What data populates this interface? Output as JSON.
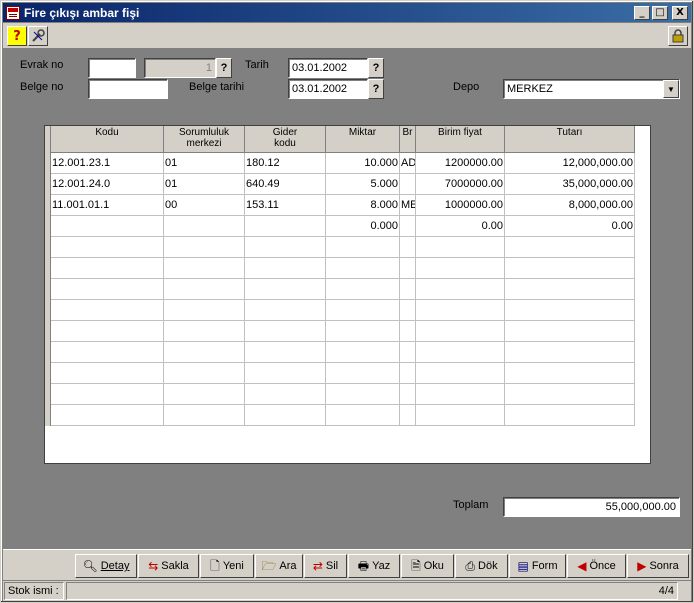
{
  "window": {
    "title": "Fire çıkışı ambar fişi",
    "minimize": "_",
    "maximize": "□",
    "close": "X"
  },
  "toolbar": {
    "help_glyph": "?"
  },
  "form": {
    "evrak_no_label": "Evrak no",
    "evrak_no_value": "",
    "evrak_no_seq": "1",
    "tarih_label": "Tarih",
    "tarih_value": "03.01.2002",
    "belge_no_label": "Belge no",
    "belge_no_value": "",
    "belge_tarihi_label": "Belge tarihi",
    "belge_tarihi_value": "03.01.2002",
    "depo_label": "Depo",
    "depo_value": "MERKEZ",
    "lookup_glyph": "?"
  },
  "grid": {
    "headers": {
      "kodu": "Kodu",
      "sorumluluk_1": "Sorumluluk",
      "sorumluluk_2": "merkezi",
      "gider_1": "Gider",
      "gider_2": "kodu",
      "miktar": "Miktar",
      "br": "Br",
      "birim_fiyat": "Birim fiyat",
      "tutari": "Tutarı"
    },
    "rows": [
      {
        "kodu": "12.001.23.1",
        "sorumluluk": "01",
        "gider": "180.12",
        "miktar": "10.000",
        "br": "AD",
        "birim": "1200000.00",
        "tutar": "12,000,000.00"
      },
      {
        "kodu": "12.001.24.0",
        "sorumluluk": "01",
        "gider": "640.49",
        "miktar": "5.000",
        "br": "",
        "birim": "7000000.00",
        "tutar": "35,000,000.00"
      },
      {
        "kodu": "11.001.01.1",
        "sorumluluk": "00",
        "gider": "153.11",
        "miktar": "8.000",
        "br": "ME",
        "birim": "1000000.00",
        "tutar": "8,000,000.00"
      },
      {
        "kodu": "",
        "sorumluluk": "",
        "gider": "",
        "miktar": "0.000",
        "br": "",
        "birim": "0.00",
        "tutar": "0.00"
      }
    ]
  },
  "totals": {
    "toplam_label": "Toplam",
    "toplam_value": "55,000,000.00"
  },
  "actions": {
    "detay": "Detay",
    "sakla": "Sakla",
    "yeni": "Yeni",
    "ara": "Ara",
    "sil": "Sil",
    "yaz": "Yaz",
    "oku": "Oku",
    "dok": "Dök",
    "form": "Form",
    "once": "Önce",
    "sonra": "Sonra"
  },
  "status": {
    "stok_ismi": "Stok ismi :",
    "record": "4/4"
  }
}
